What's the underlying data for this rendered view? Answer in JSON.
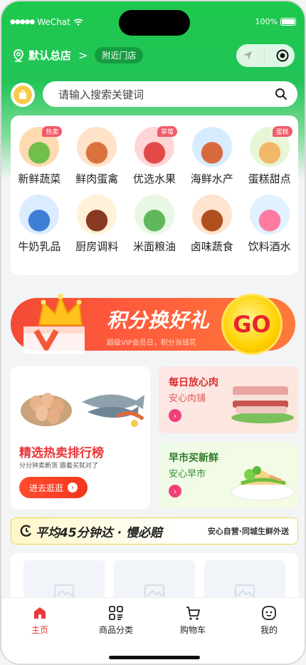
{
  "status_bar": {
    "carrier": "WeChat",
    "battery": "100%"
  },
  "header": {
    "store_name": "默认总店",
    "nearby_label": "附近门店",
    "search_placeholder": "请输入搜索关键词"
  },
  "categories": [
    {
      "label": "新鲜蔬菜",
      "badge": "热卖",
      "color": "#ffd9b0",
      "color2": "#6fbf4a"
    },
    {
      "label": "鲜肉蛋禽",
      "badge": "",
      "color": "#ffe2c8",
      "color2": "#d9723c"
    },
    {
      "label": "优选水果",
      "badge": "草莓",
      "color": "#ffd6d6",
      "color2": "#e24a4a"
    },
    {
      "label": "海鲜水产",
      "badge": "",
      "color": "#d8ecff",
      "color2": "#d66a3c"
    },
    {
      "label": "蛋糕甜点",
      "badge": "蛋糕",
      "color": "#e8f6d8",
      "color2": "#f2b86a"
    },
    {
      "label": "牛奶乳品",
      "badge": "",
      "color": "#dcecff",
      "color2": "#3d7fd6"
    },
    {
      "label": "厨房调料",
      "badge": "",
      "color": "#fff2d8",
      "color2": "#8a3a22"
    },
    {
      "label": "米面粮油",
      "badge": "",
      "color": "#e9f8e4",
      "color2": "#5fb85a"
    },
    {
      "label": "卤味蔬食",
      "badge": "",
      "color": "#ffe4d0",
      "color2": "#b0501e"
    },
    {
      "label": "饮料酒水",
      "badge": "",
      "color": "#e0f1ff",
      "color2": "#ff7aa0"
    }
  ],
  "banner": {
    "title": "积分换好礼",
    "subtitle": "超级VIP会员日，积分当钱花",
    "go": "GO"
  },
  "promo_left": {
    "title": "精选热卖排行榜",
    "subtitle": "分分钟卖断货 跟着买就对了",
    "button": "进去逛逛"
  },
  "promo_right": [
    {
      "title": "每日放心肉",
      "subtitle": "安心肉铺",
      "title_color": "#d9302f",
      "sub_color": "#e05a5a"
    },
    {
      "title": "早市买新鲜",
      "subtitle": "安心早市",
      "title_color": "#2f7a2a",
      "sub_color": "#3a8a35"
    }
  ],
  "delivery": {
    "left": "平均45分钟达 · 慢必赔",
    "right": "安心自营·同城生鲜外送"
  },
  "tabbar": [
    {
      "label": "主页",
      "icon": "home-icon",
      "active": true
    },
    {
      "label": "商品分类",
      "icon": "category-grid-icon",
      "active": false
    },
    {
      "label": "购物车",
      "icon": "cart-icon",
      "active": false
    },
    {
      "label": "我的",
      "icon": "profile-face-icon",
      "active": false
    }
  ],
  "colors": {
    "brand_green": "#1ec84d",
    "accent_red": "#e8383a"
  }
}
